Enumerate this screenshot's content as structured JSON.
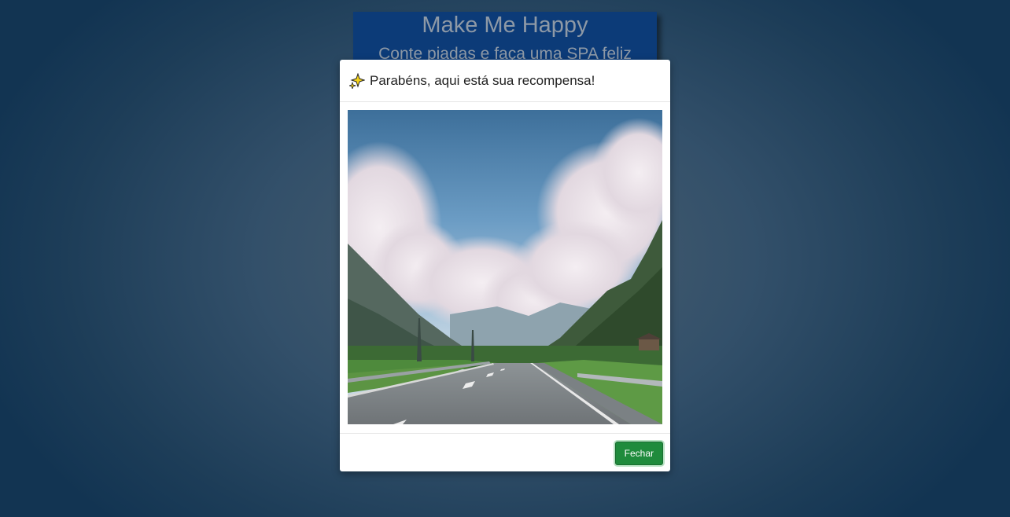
{
  "header": {
    "title": "Make Me Happy",
    "subtitle": "Conte piadas e faça uma SPA feliz",
    "background_color": "#0c3b78"
  },
  "modal": {
    "title": "Parabéns, aqui está sua recompensa!",
    "title_icon": "sparkle-icon",
    "image_subject": "mountain-road-landscape",
    "close_label": "Fechar",
    "close_color": "#1f8b3c"
  }
}
